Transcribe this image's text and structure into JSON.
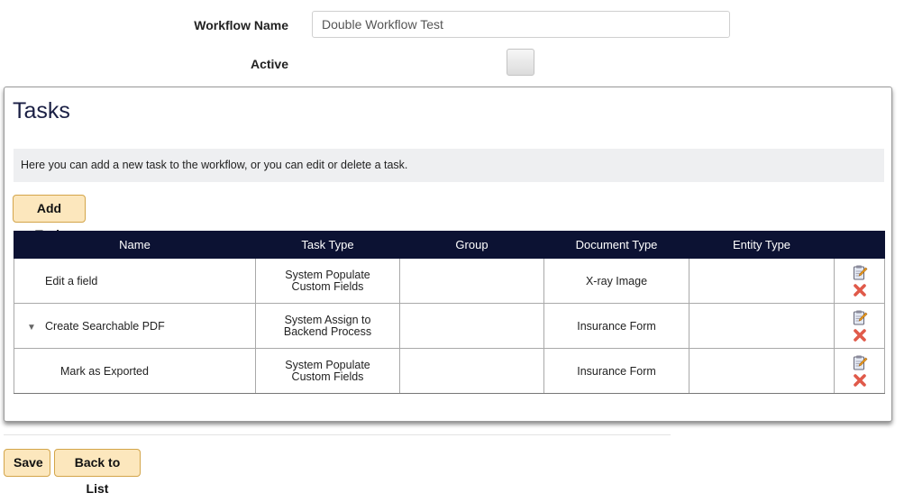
{
  "form": {
    "workflow_name_label": "Workflow Name",
    "workflow_name_value": "Double Workflow Test",
    "active_label": "Active",
    "active_checked": false
  },
  "tasks_panel": {
    "title": "Tasks",
    "info": "Here you can add a new task to the workflow, or you can edit or delete a task.",
    "add_task_label": "Add Task"
  },
  "table": {
    "columns": [
      "Name",
      "Task Type",
      "Group",
      "Document Type",
      "Entity Type",
      ""
    ],
    "rows": [
      {
        "name": "Edit a field",
        "task_type": "System Populate Custom Fields",
        "group": "",
        "document_type": "X-ray Image",
        "entity_type": "",
        "expandable": false
      },
      {
        "name": "Create Searchable PDF",
        "task_type": "System Assign to Backend Process",
        "group": "",
        "document_type": "Insurance Form",
        "entity_type": "",
        "expandable": true,
        "expand_glyph": "▼"
      },
      {
        "name": "Mark as Exported",
        "task_type": "System Populate Custom Fields",
        "group": "",
        "document_type": "Insurance Form",
        "entity_type": "",
        "expandable": false
      }
    ]
  },
  "footer": {
    "save_label": "Save",
    "back_label": "Back to List"
  },
  "colors": {
    "header_bg": "#0c1233",
    "button_bg": "#fce7bd",
    "button_border": "#d3a54a",
    "title_color": "#1a1f44",
    "delete_red": "#e05a4a"
  },
  "icons": {
    "edit": "edit-clipboard-icon",
    "delete": "delete-x-icon",
    "expand": "triangle-down-icon"
  }
}
